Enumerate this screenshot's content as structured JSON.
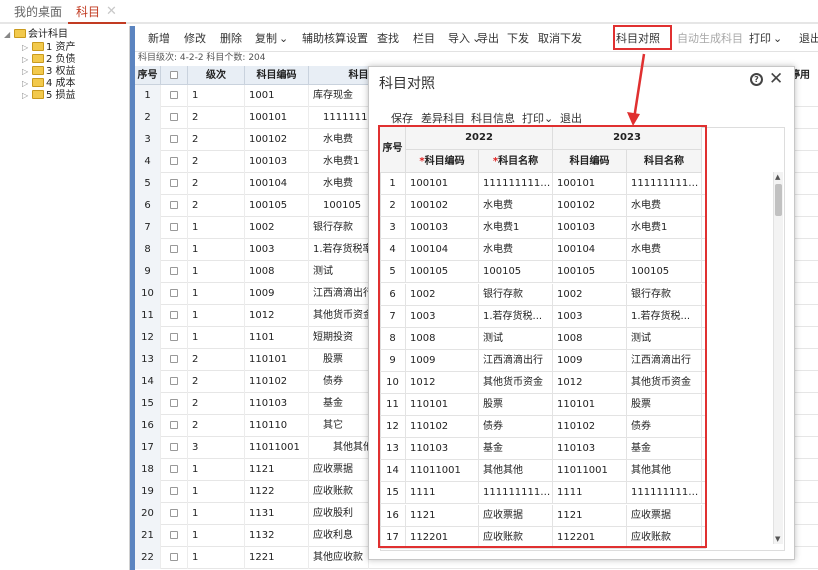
{
  "tabs": {
    "home": "我的桌面",
    "active": "科目",
    "close": "✕"
  },
  "tree": {
    "root": "会计科目",
    "items": [
      "1 资产",
      "2 负债",
      "3 权益",
      "4 成本",
      "5 损益"
    ]
  },
  "toolbar": [
    "新增",
    "修改",
    "删除",
    "复制",
    "辅助核算设置",
    "查找",
    "栏目",
    "导入",
    "导出",
    "下发",
    "取消下发",
    "科目对照",
    "自动生成科目",
    "打印",
    "退出"
  ],
  "toolbar_disabled": [
    false,
    false,
    false,
    false,
    false,
    false,
    false,
    false,
    false,
    false,
    false,
    false,
    true,
    false,
    false
  ],
  "toolbar_dropdown": [
    false,
    false,
    false,
    true,
    false,
    false,
    false,
    true,
    false,
    false,
    false,
    false,
    false,
    true,
    false
  ],
  "dropdown_glyph": "⌄",
  "info": "科目级次: 4-2-2   科目个数: 204",
  "grid": {
    "headers": [
      "序号",
      "",
      "级次",
      "科目编码",
      "科目"
    ],
    "right_header": "停用",
    "rows": [
      [
        "1",
        "1",
        "1001",
        "库存现金"
      ],
      [
        "2",
        "2",
        "100101",
        "111111111"
      ],
      [
        "3",
        "2",
        "100102",
        "水电费"
      ],
      [
        "4",
        "2",
        "100103",
        "水电费1"
      ],
      [
        "5",
        "2",
        "100104",
        "水电费"
      ],
      [
        "6",
        "2",
        "100105",
        "100105"
      ],
      [
        "7",
        "1",
        "1002",
        "银行存款"
      ],
      [
        "8",
        "1",
        "1003",
        "1.若存货税率"
      ],
      [
        "9",
        "1",
        "1008",
        "测试"
      ],
      [
        "10",
        "1",
        "1009",
        "江西滴滴出行"
      ],
      [
        "11",
        "1",
        "1012",
        "其他货币资金"
      ],
      [
        "12",
        "1",
        "1101",
        "短期投资"
      ],
      [
        "13",
        "2",
        "110101",
        "股票"
      ],
      [
        "14",
        "2",
        "110102",
        "债券"
      ],
      [
        "15",
        "2",
        "110103",
        "基金"
      ],
      [
        "16",
        "2",
        "110110",
        "其它"
      ],
      [
        "17",
        "3",
        "11011001",
        "其他其他"
      ],
      [
        "18",
        "1",
        "1121",
        "应收票据"
      ],
      [
        "19",
        "1",
        "1122",
        "应收账款"
      ],
      [
        "20",
        "1",
        "1131",
        "应收股利"
      ],
      [
        "21",
        "1",
        "1132",
        "应收利息"
      ],
      [
        "22",
        "1",
        "1221",
        "其他应收款"
      ]
    ],
    "indent": [
      0,
      1,
      1,
      1,
      1,
      1,
      0,
      0,
      0,
      0,
      0,
      0,
      1,
      1,
      1,
      1,
      2,
      0,
      0,
      0,
      0,
      0
    ]
  },
  "modal": {
    "title": "科目对照",
    "help": "?",
    "close": "✕",
    "toolbar": [
      "保存",
      "差异科目",
      "科目信息",
      "打印",
      "退出"
    ],
    "table": {
      "seq_header": "序号",
      "year_left": "2022",
      "year_right": "2023",
      "sub_headers": [
        "科目编码",
        "科目名称",
        "科目编码",
        "科目名称"
      ],
      "required_mark": "*",
      "rows": [
        [
          "1",
          "100101",
          "1111111111...",
          "100101",
          "1111111111..."
        ],
        [
          "2",
          "100102",
          "水电费",
          "100102",
          "水电费"
        ],
        [
          "3",
          "100103",
          "水电费1",
          "100103",
          "水电费1"
        ],
        [
          "4",
          "100104",
          "水电费",
          "100104",
          "水电费"
        ],
        [
          "5",
          "100105",
          "100105",
          "100105",
          "100105"
        ],
        [
          "6",
          "1002",
          "银行存款",
          "1002",
          "银行存款"
        ],
        [
          "7",
          "1003",
          "1.若存货税...",
          "1003",
          "1.若存货税..."
        ],
        [
          "8",
          "1008",
          "测试",
          "1008",
          "测试"
        ],
        [
          "9",
          "1009",
          "江西滴滴出行",
          "1009",
          "江西滴滴出行"
        ],
        [
          "10",
          "1012",
          "其他货币资金",
          "1012",
          "其他货币资金"
        ],
        [
          "11",
          "110101",
          "股票",
          "110101",
          "股票"
        ],
        [
          "12",
          "110102",
          "债券",
          "110102",
          "债券"
        ],
        [
          "13",
          "110103",
          "基金",
          "110103",
          "基金"
        ],
        [
          "14",
          "11011001",
          "其他其他",
          "11011001",
          "其他其他"
        ],
        [
          "15",
          "1111",
          "1111111111...",
          "1111",
          "1111111111..."
        ],
        [
          "16",
          "1121",
          "应收票据",
          "1121",
          "应收票据"
        ],
        [
          "17",
          "112201",
          "应收账款",
          "112201",
          "应收账款"
        ]
      ]
    }
  },
  "colors": {
    "accent": "#c23b22",
    "highlight": "#e03030",
    "divider": "#5b84c0",
    "folder": "#f2c94c"
  }
}
